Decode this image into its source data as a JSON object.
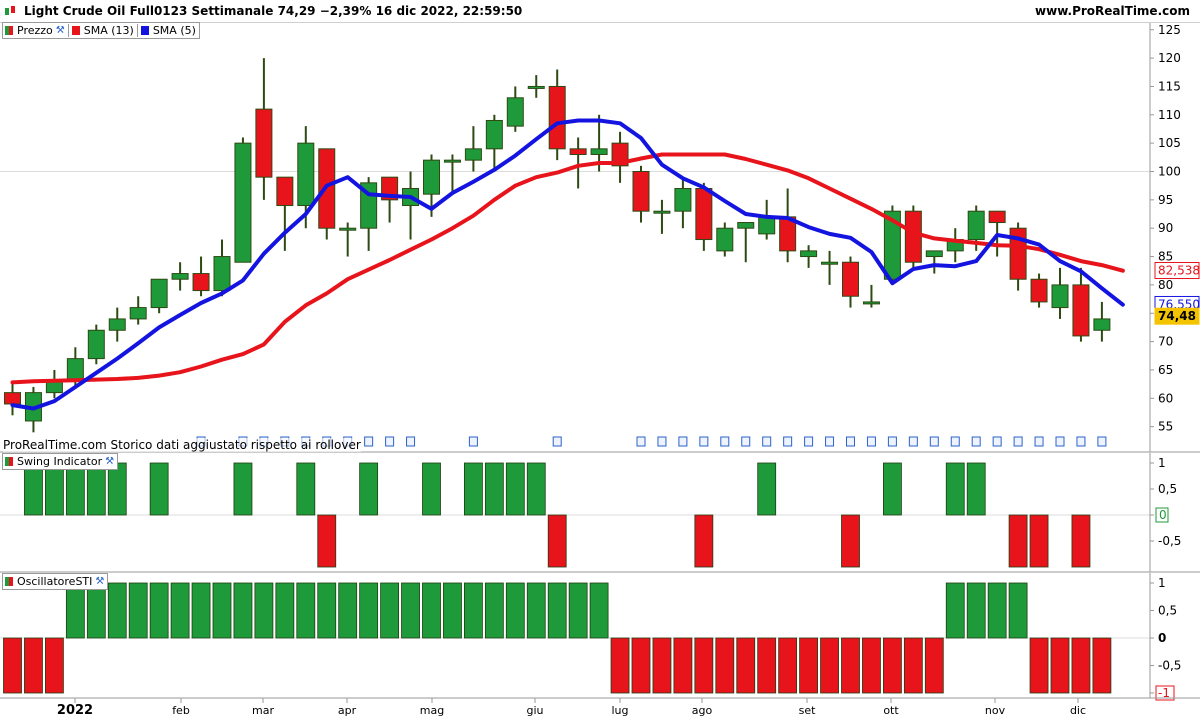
{
  "header": {
    "title": "Light Crude Oil Full0123 Settimanale 74,29 −2,39% 16 dic 2022, 22:59:50",
    "site": "www.ProRealTime.com"
  },
  "legend_price": {
    "items": [
      {
        "label": "Prezzo",
        "color": "#1e9a3a"
      },
      {
        "label": "SMA (13)",
        "color": "#e8141b"
      },
      {
        "label": "SMA (5)",
        "color": "#1414e0"
      }
    ]
  },
  "legend_swing": {
    "label": "Swing Indicator"
  },
  "legend_osc": {
    "label": "OscillatoreSTI"
  },
  "footnote": "ProRealTime.com  Storico dati aggiustato rispetto ai rollover",
  "colors": {
    "up": "#1e9a3a",
    "down": "#e8141b",
    "sma13": "#e8141b",
    "sma5": "#1414e0",
    "current_tag": "#f5c400",
    "grid": "#dcdcdc",
    "axis": "#9a9a9a"
  },
  "price_axis_ticks": [
    "125",
    "120",
    "115",
    "110",
    "105",
    "100",
    "95",
    "90",
    "85",
    "80",
    "75",
    "70",
    "65",
    "60",
    "55"
  ],
  "tags": {
    "sma13": "82,538",
    "sma5": "76,550",
    "price": "74,48"
  },
  "swing_axis_ticks": [
    "1",
    "0,5",
    "0",
    "-0,5"
  ],
  "osc_axis_ticks": [
    "1",
    "0,5",
    "0",
    "-0,5",
    "-1"
  ],
  "x_axis_labels": [
    "2022",
    "feb",
    "mar",
    "apr",
    "mag",
    "giu",
    "lug",
    "ago",
    "set",
    "ott",
    "nov",
    "dic"
  ],
  "chart_data": [
    {
      "type": "candlestick",
      "title": "Light Crude Oil Full0123 Settimanale",
      "ylim": [
        52,
        127
      ],
      "candles": [
        [
          61,
          59,
          63,
          57
        ],
        [
          56,
          61,
          62,
          54
        ],
        [
          61,
          63,
          65,
          60
        ],
        [
          63,
          67,
          69,
          62
        ],
        [
          67,
          72,
          73,
          66
        ],
        [
          72,
          74,
          76,
          70
        ],
        [
          74,
          76,
          78,
          73
        ],
        [
          76,
          81,
          81,
          75
        ],
        [
          81,
          82,
          84,
          79
        ],
        [
          82,
          79,
          85,
          78
        ],
        [
          79,
          85,
          88,
          78
        ],
        [
          84,
          105,
          106,
          84
        ],
        [
          111,
          99,
          120,
          95
        ],
        [
          99,
          94,
          99,
          86
        ],
        [
          94,
          105,
          108,
          90
        ],
        [
          104,
          90,
          104,
          88
        ],
        [
          90,
          90,
          91,
          85
        ],
        [
          90,
          98,
          99,
          86
        ],
        [
          99,
          95,
          99,
          91
        ],
        [
          94,
          97,
          100,
          88
        ],
        [
          96,
          102,
          103,
          92
        ],
        [
          102,
          102,
          103,
          96
        ],
        [
          102,
          104,
          108,
          100
        ],
        [
          104,
          109,
          110,
          100
        ],
        [
          108,
          113,
          115,
          107
        ],
        [
          115,
          115,
          117,
          113
        ],
        [
          115,
          104,
          118,
          102
        ],
        [
          104,
          103,
          106,
          97
        ],
        [
          103,
          104,
          110,
          100
        ],
        [
          105,
          101,
          107,
          98
        ],
        [
          100,
          93,
          101,
          91
        ],
        [
          93,
          93,
          95,
          89
        ],
        [
          93,
          97,
          99,
          90
        ],
        [
          97,
          88,
          98,
          86
        ],
        [
          86,
          90,
          91,
          85
        ],
        [
          90,
          91,
          91,
          84
        ],
        [
          89,
          92,
          95,
          88
        ],
        [
          92,
          86,
          97,
          84
        ],
        [
          85,
          86,
          87,
          83
        ],
        [
          84,
          84,
          86,
          80
        ],
        [
          84,
          78,
          85,
          76
        ],
        [
          77,
          77,
          80,
          76
        ],
        [
          81,
          93,
          94,
          80
        ],
        [
          93,
          84,
          94,
          83
        ],
        [
          85,
          86,
          86,
          82
        ],
        [
          86,
          88,
          90,
          84
        ],
        [
          88,
          93,
          94,
          86
        ],
        [
          93,
          91,
          93,
          85
        ],
        [
          90,
          81,
          91,
          79
        ],
        [
          81,
          77,
          82,
          76
        ],
        [
          76,
          80,
          83,
          74
        ],
        [
          80,
          71,
          83,
          70
        ],
        [
          72,
          74,
          77,
          70
        ]
      ],
      "series": [
        {
          "name": "SMA (13)",
          "values": [
            62.8,
            63.0,
            63.1,
            63.2,
            63.3,
            63.4,
            63.6,
            64.0,
            64.6,
            65.6,
            66.8,
            67.8,
            69.5,
            73.5,
            76.4,
            78.5,
            81.0,
            82.7,
            84.4,
            86.2,
            88.0,
            90.0,
            92.2,
            95.0,
            97.5,
            99.0,
            99.8,
            101.0,
            101.5,
            101.5,
            102.3,
            103.0,
            103.0,
            103.0,
            103.0,
            102.2,
            101.2,
            100.2,
            98.8,
            97.0,
            95.2,
            93.4,
            91.4,
            89.2,
            88.2,
            87.8,
            87.4,
            87.0,
            86.9,
            86.3,
            85.3,
            84.2,
            83.5,
            82.5
          ]
        },
        {
          "name": "SMA (5)",
          "values": [
            58.8,
            58.2,
            59.5,
            62.0,
            64.5,
            67.0,
            69.7,
            72.5,
            74.7,
            76.8,
            78.5,
            80.8,
            85.5,
            89.2,
            92.5,
            97.5,
            99.0,
            96.0,
            95.7,
            95.5,
            93.4,
            96.2,
            98.2,
            100.3,
            102.8,
            105.7,
            108.5,
            109.0,
            109.0,
            108.5,
            105.9,
            101.2,
            98.8,
            97.2,
            94.8,
            92.5,
            92.0,
            91.8,
            90.2,
            89.0,
            88.3,
            85.8,
            80.3,
            82.8,
            83.5,
            83.3,
            84.2,
            88.8,
            88.2,
            87.1,
            84.2,
            82.4,
            79.4,
            76.5
          ]
        }
      ]
    },
    {
      "type": "bar",
      "title": "Swing Indicator",
      "ylim": [
        -1,
        1
      ],
      "values": [
        0,
        1,
        1,
        1,
        1,
        1,
        0,
        1,
        0,
        0,
        0,
        1,
        0,
        0,
        1,
        -1,
        0,
        1,
        0,
        0,
        1,
        0,
        1,
        1,
        1,
        1,
        -1,
        0,
        0,
        0,
        0,
        0,
        0,
        -1,
        0,
        0,
        1,
        0,
        0,
        0,
        -1,
        0,
        1,
        0,
        0,
        1,
        1,
        0,
        -1,
        -1,
        0,
        -1,
        0
      ]
    },
    {
      "type": "bar",
      "title": "OscillatoreSTI",
      "ylim": [
        -1,
        1
      ],
      "values": [
        -1,
        -1,
        -1,
        1,
        1,
        1,
        1,
        1,
        1,
        1,
        1,
        1,
        1,
        1,
        1,
        1,
        1,
        1,
        1,
        1,
        1,
        1,
        1,
        1,
        1,
        1,
        1,
        1,
        1,
        -1,
        -1,
        -1,
        -1,
        -1,
        -1,
        -1,
        -1,
        -1,
        -1,
        -1,
        -1,
        -1,
        -1,
        -1,
        -1,
        1,
        1,
        1,
        1,
        -1,
        -1,
        -1,
        -1
      ]
    }
  ]
}
